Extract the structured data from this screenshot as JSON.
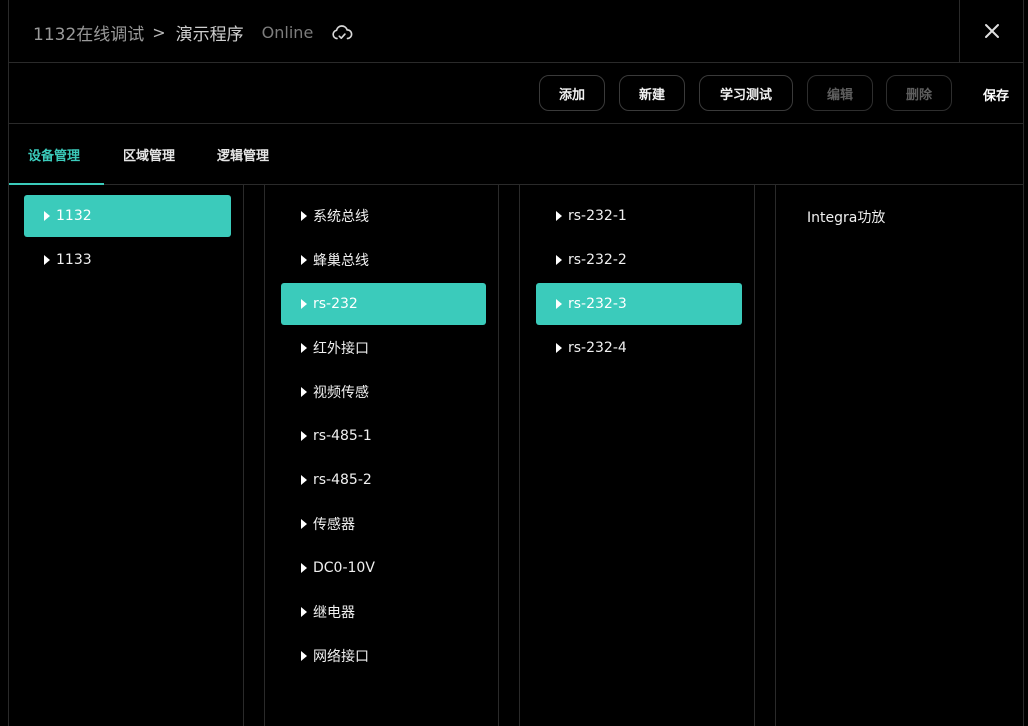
{
  "header": {
    "breadcrumb_root": "1132在线调试",
    "breadcrumb_sep": ">",
    "program": "演示程序",
    "status": "Online"
  },
  "toolbar": {
    "add": "添加",
    "new": "新建",
    "learn_test": "学习测试",
    "edit": "编辑",
    "delete": "删除",
    "save": "保存"
  },
  "tabs": [
    "设备管理",
    "区域管理",
    "逻辑管理"
  ],
  "col1": [
    "1132",
    "1133"
  ],
  "col2": [
    "系统总线",
    "蜂巢总线",
    "rs-232",
    "红外接口",
    "视频传感",
    "rs-485-1",
    "rs-485-2",
    "传感器",
    "DC0-10V",
    "继电器",
    "网络接口"
  ],
  "col3": [
    "rs-232-1",
    "rs-232-2",
    "rs-232-3",
    "rs-232-4"
  ],
  "col4": [
    "Integra功放"
  ],
  "colors": {
    "accent": "#3bcbbb",
    "background": "#000000"
  }
}
